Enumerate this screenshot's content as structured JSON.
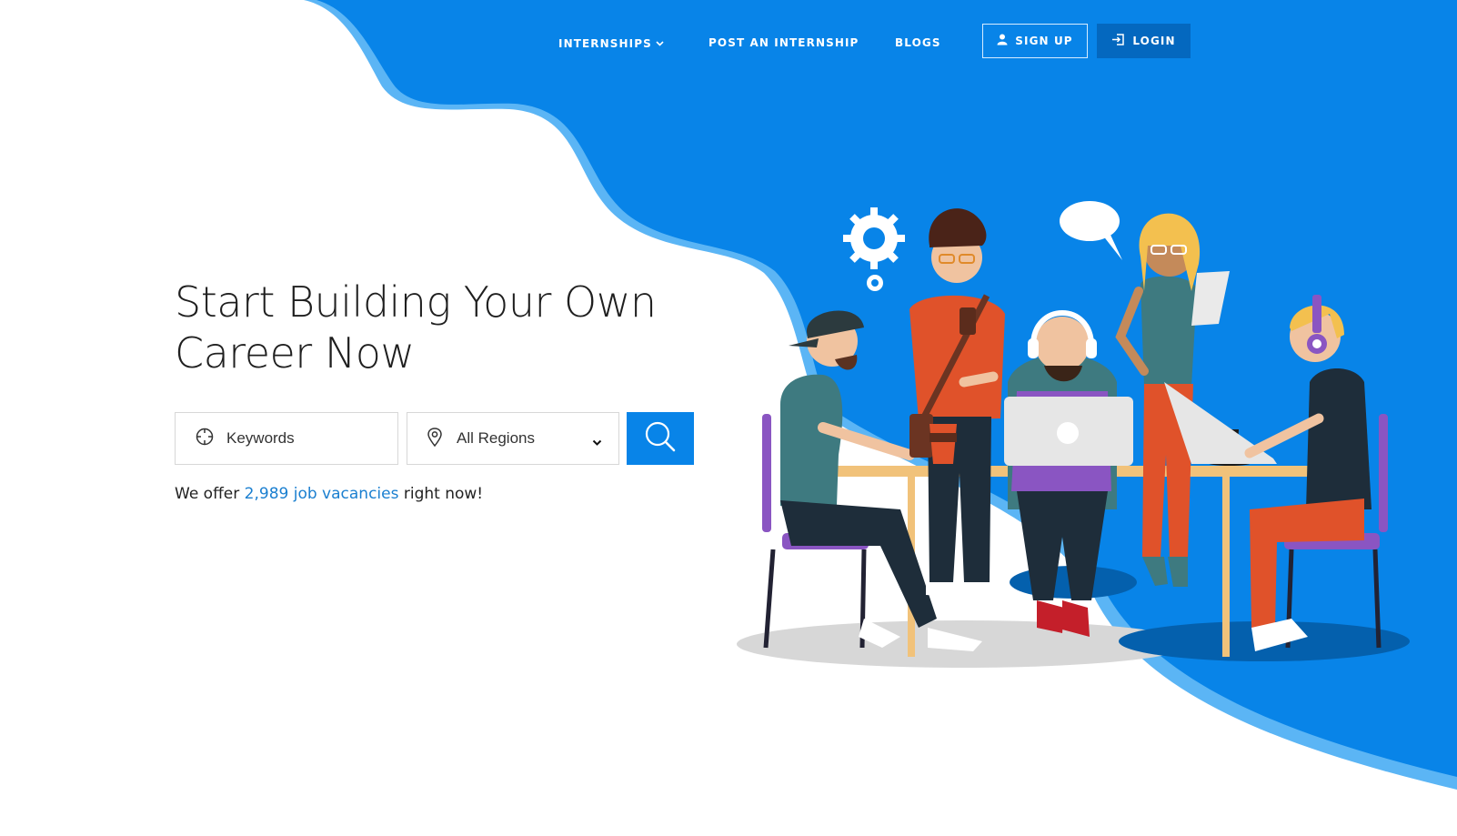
{
  "nav": {
    "items": [
      {
        "label": "INTERNSHIPS",
        "has_dropdown": true
      },
      {
        "label": "POST AN INTERNSHIP",
        "has_dropdown": false
      },
      {
        "label": "BLOGS",
        "has_dropdown": false
      }
    ],
    "signup_label": "SIGN UP",
    "login_label": "LOGIN"
  },
  "hero": {
    "headline_line1": "Start Building Your Own",
    "headline_line2": "Career Now",
    "search": {
      "keywords_placeholder": "Keywords",
      "region_value": "All Regions",
      "search_icon": "search-icon"
    },
    "offer": {
      "prefix": "We offer ",
      "link": "2,989 job vacancies",
      "suffix": " right now!"
    }
  },
  "colors": {
    "brand_blue": "#0884e8",
    "dark_blue": "#0468bf",
    "wave_edge": "#5bb5f5",
    "link": "#1a7fd0"
  },
  "icons": [
    "chevron-down-icon",
    "user-icon",
    "login-icon",
    "crosshair-icon",
    "map-pin-icon",
    "caret-down-icon",
    "search-icon"
  ]
}
